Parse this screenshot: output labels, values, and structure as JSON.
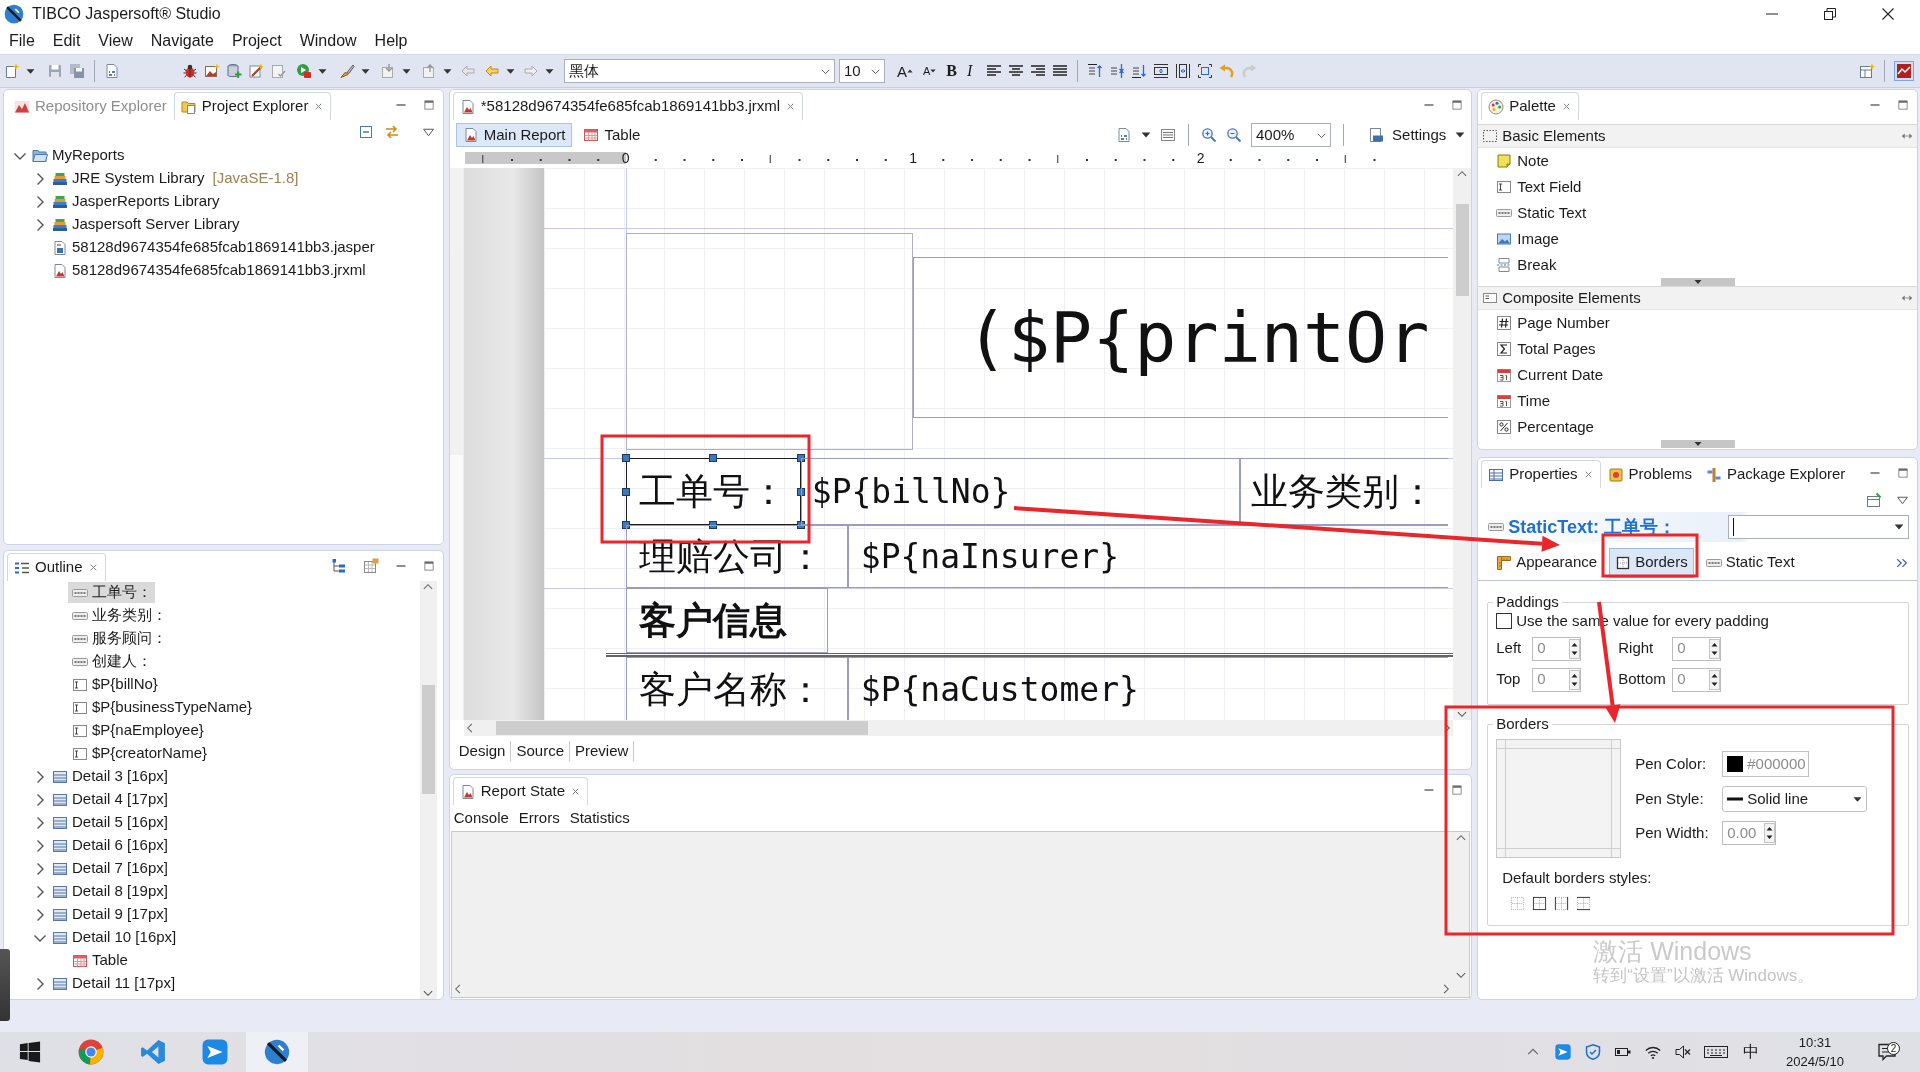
{
  "window": {
    "title": "TIBCO Jaspersoft® Studio"
  },
  "menu": [
    "File",
    "Edit",
    "View",
    "Navigate",
    "Project",
    "Window",
    "Help"
  ],
  "toolbar": {
    "font": "黑体",
    "font_size": "10",
    "text_buttons": [
      {
        "label": "A",
        "kind": "grow"
      },
      {
        "label": "A",
        "kind": "shrink"
      },
      {
        "label": "B",
        "kind": "bold"
      },
      {
        "label": "I",
        "kind": "italic"
      }
    ]
  },
  "project_explorer": {
    "tabs": [
      {
        "label": "Repository Explorer",
        "kind": "repository",
        "selected": false,
        "greyed": true
      },
      {
        "label": "Project Explorer",
        "kind": "project",
        "selected": true,
        "greyed": false
      }
    ],
    "tree": [
      {
        "label": "MyReports",
        "kind": "project",
        "expanded": true,
        "children": [
          {
            "label": "JRE System Library",
            "decoration": "[JavaSE-1.8]",
            "kind": "library",
            "expanded": false
          },
          {
            "label": "JasperReports Library",
            "kind": "library",
            "expanded": false
          },
          {
            "label": "Jaspersoft Server Library",
            "kind": "library",
            "expanded": false
          },
          {
            "label": "58128d9674354fe685fcab1869141bb3.jasper",
            "kind": "compiled"
          },
          {
            "label": "58128d9674354fe685fcab1869141bb3.jrxml",
            "kind": "report"
          }
        ]
      }
    ]
  },
  "outline": {
    "tab": "Outline",
    "tree": [
      {
        "children": [
          {
            "children": [
              {
                "label": "工单号：",
                "kind": "label",
                "selected": true
              },
              {
                "label": "业务类别：",
                "kind": "label",
                "selected": false
              },
              {
                "label": "服务顾问：",
                "kind": "label",
                "selected": false
              },
              {
                "label": "创建人：",
                "kind": "label",
                "selected": false
              },
              {
                "label": "$P{billNo}",
                "kind": "field",
                "selected": false
              },
              {
                "label": "$P{businessTypeName}",
                "kind": "field",
                "selected": false
              },
              {
                "label": "$P{naEmployee}",
                "kind": "field",
                "selected": false
              },
              {
                "label": "$P{creatorName}",
                "kind": "field",
                "selected": false
              }
            ]
          },
          {
            "label": "Detail 3 [16px]",
            "kind": "band",
            "expanded": false,
            "selected": false
          },
          {
            "label": "Detail 4 [17px]",
            "kind": "band",
            "expanded": false,
            "selected": false
          },
          {
            "label": "Detail 5 [16px]",
            "kind": "band",
            "expanded": false,
            "selected": false
          },
          {
            "label": "Detail 6 [16px]",
            "kind": "band",
            "expanded": false,
            "selected": false
          },
          {
            "label": "Detail 7 [16px]",
            "kind": "band",
            "expanded": false,
            "selected": false
          },
          {
            "label": "Detail 8 [19px]",
            "kind": "band",
            "expanded": false,
            "selected": false
          },
          {
            "label": "Detail 9 [17px]",
            "kind": "band",
            "expanded": false,
            "selected": false
          },
          {
            "label": "Detail 10 [16px]",
            "kind": "band",
            "expanded": true,
            "selected": false,
            "children": [
              {
                "label": "Table",
                "kind": "table",
                "selected": false
              }
            ]
          },
          {
            "label": "Detail 11 [17px]",
            "kind": "band",
            "expanded": false,
            "selected": false
          }
        ]
      }
    ]
  },
  "editor": {
    "tab": "*58128d9674354fe685fcab1869141bb3.jrxml",
    "views": [
      {
        "label": "Main Report",
        "kind": "report",
        "selected": true
      },
      {
        "label": "Table",
        "kind": "table",
        "selected": false
      }
    ],
    "zoom": "400%",
    "settings": "Settings",
    "ruler": [
      "0",
      "1",
      "2"
    ],
    "elements": [
      {
        "kind": "image",
        "selected": false
      },
      {
        "kind": "field",
        "text": "($P{printOr",
        "selected": false
      },
      {
        "kind": "label",
        "text": "工单号：",
        "selected": true
      },
      {
        "kind": "field",
        "text": "$P{billNo}",
        "selected": false
      },
      {
        "kind": "label",
        "text": "业务类别：",
        "selected": false
      },
      {
        "kind": "label",
        "text": "理赔公司：",
        "selected": false
      },
      {
        "kind": "field",
        "text": "$P{naInsurer}",
        "selected": false
      },
      {
        "kind": "heading",
        "text": "客户信息",
        "selected": false
      },
      {
        "kind": "label",
        "text": "客户名称：",
        "selected": false
      },
      {
        "kind": "field",
        "text": "$P{naCustomer}",
        "selected": false
      }
    ],
    "modes": [
      "Design",
      "Source",
      "Preview"
    ]
  },
  "report_state": {
    "tab": "Report State",
    "tabs": [
      "Console",
      "Errors",
      "Statistics"
    ]
  },
  "palette": {
    "tab": "Palette",
    "groups": [
      {
        "title": "Basic Elements",
        "kind": "basic",
        "items": [
          {
            "label": "Note",
            "kind": "note"
          },
          {
            "label": "Text Field",
            "kind": "textbox"
          },
          {
            "label": "Static Text",
            "kind": "label"
          },
          {
            "label": "Image",
            "kind": "picture"
          },
          {
            "label": "Break",
            "kind": "pagebreak"
          }
        ]
      },
      {
        "title": "Composite Elements",
        "kind": "composite",
        "items": [
          {
            "label": "Page Number",
            "kind": "hash"
          },
          {
            "label": "Total Pages",
            "kind": "sigma"
          },
          {
            "label": "Current Date",
            "kind": "calendar"
          },
          {
            "label": "Time",
            "kind": "calendar"
          },
          {
            "label": "Percentage",
            "kind": "percent"
          }
        ]
      }
    ]
  },
  "properties": {
    "tabs": [
      {
        "label": "Properties",
        "kind": "properties",
        "selected": true
      },
      {
        "label": "Problems",
        "kind": "problems",
        "selected": false
      },
      {
        "label": "Package Explorer",
        "kind": "packages",
        "selected": false
      }
    ],
    "title": "StaticText: 工单号：",
    "sections": [
      {
        "label": "Appearance",
        "kind": "appearance",
        "selected": false
      },
      {
        "label": "Borders",
        "kind": "borders",
        "selected": true
      },
      {
        "label": "Static Text",
        "kind": "label",
        "selected": false
      }
    ],
    "paddings": {
      "title": "Paddings",
      "same_value": {
        "label": "Use the same value for every padding",
        "checked": false
      },
      "fields": [
        {
          "label": "Left",
          "value": "0"
        },
        {
          "label": "Right",
          "value": "0"
        },
        {
          "label": "Top",
          "value": "0"
        },
        {
          "label": "Bottom",
          "value": "0"
        }
      ]
    },
    "borders": {
      "title": "Borders",
      "pen_color": {
        "label": "Pen Color:",
        "value": "#000000"
      },
      "pen_style": {
        "label": "Pen Style:",
        "value": "Solid line"
      },
      "pen_width": {
        "label": "Pen Width:",
        "value": "0.00"
      },
      "defaults_label": "Default borders styles:"
    }
  },
  "os_watermark": {
    "title": "激活 Windows",
    "hint": "转到“设置”以激活 Windows。"
  },
  "taskbar": {
    "apps": [
      {
        "kind": "browser",
        "selected": false
      },
      {
        "kind": "code",
        "selected": false
      },
      {
        "kind": "plane",
        "selected": false
      },
      {
        "kind": "studio",
        "selected": true
      }
    ],
    "ime": "中",
    "time": "10:31",
    "date": "2024/5/10",
    "notifications": "2"
  },
  "annotations": [
    {
      "kind": "box"
    },
    {
      "kind": "box"
    },
    {
      "kind": "box"
    },
    {
      "kind": "arrow"
    },
    {
      "kind": "arrow"
    }
  ]
}
